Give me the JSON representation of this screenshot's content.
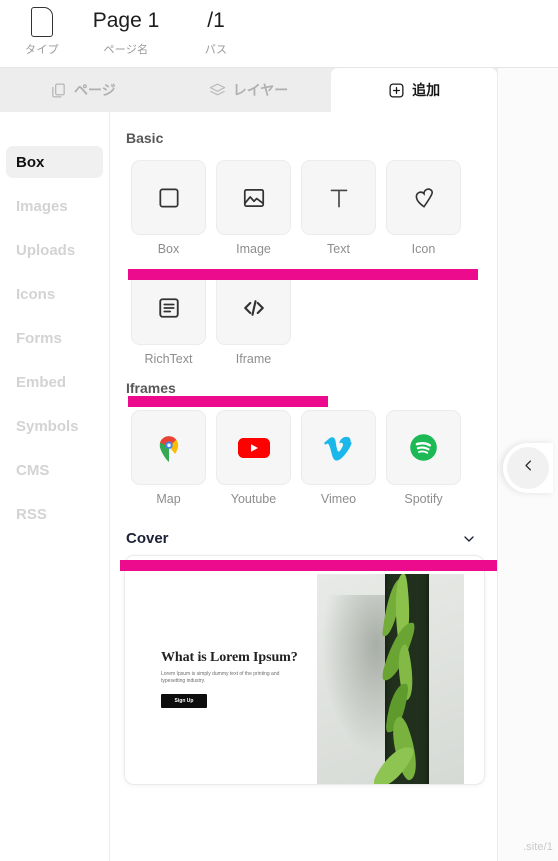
{
  "topbar": {
    "fields": [
      {
        "value": "",
        "label": "タイプ",
        "icon": "page-document-icon"
      },
      {
        "value": "Page 1",
        "label": "ページ名"
      },
      {
        "value": "/1",
        "label": "パス"
      }
    ]
  },
  "tabs": [
    {
      "label": "ページ",
      "icon": "pages-icon",
      "active": false
    },
    {
      "label": "レイヤー",
      "icon": "layers-icon",
      "active": false
    },
    {
      "label": "追加",
      "icon": "plus-square-icon",
      "active": true
    }
  ],
  "sidebar": {
    "items": [
      {
        "label": "Box",
        "active": true
      },
      {
        "label": "Images",
        "active": false
      },
      {
        "label": "Uploads",
        "active": false
      },
      {
        "label": "Icons",
        "active": false
      },
      {
        "label": "Forms",
        "active": false
      },
      {
        "label": "Embed",
        "active": false
      },
      {
        "label": "Symbols",
        "active": false
      },
      {
        "label": "CMS",
        "active": false
      },
      {
        "label": "RSS",
        "active": false
      }
    ]
  },
  "sections": {
    "basic": {
      "title": "Basic",
      "items": [
        {
          "label": "Box",
          "icon": "square-icon"
        },
        {
          "label": "Image",
          "icon": "image-icon"
        },
        {
          "label": "Text",
          "icon": "text-t-icon"
        },
        {
          "label": "Icon",
          "icon": "heart-icon"
        },
        {
          "label": "RichText",
          "icon": "richtext-icon"
        },
        {
          "label": "Iframe",
          "icon": "code-icon"
        }
      ]
    },
    "iframes": {
      "title": "Iframes",
      "items": [
        {
          "label": "Map",
          "icon": "google-maps-pin-icon"
        },
        {
          "label": "Youtube",
          "icon": "youtube-icon"
        },
        {
          "label": "Vimeo",
          "icon": "vimeo-icon"
        },
        {
          "label": "Spotify",
          "icon": "spotify-icon"
        }
      ]
    },
    "cover": {
      "title": "Cover",
      "chevron_icon": "chevron-down-icon",
      "preview": {
        "heading": "What is Lorem Ipsum?",
        "paragraph": "Lorem Ipsum is simply dummy text of the printing and typesetting industry.",
        "button_label": "Sign Up"
      }
    }
  },
  "collapse_button": {
    "icon": "chevron-left-icon"
  },
  "canvas": {
    "url_fragment": ".site/1"
  },
  "colors": {
    "highlight": "#ec0b8c",
    "active_tab_text": "#171717",
    "inactive_text": "#b0b0b0",
    "spotify_green": "#1db954",
    "youtube_red": "#ff0000",
    "vimeo_blue": "#1ab7ea"
  }
}
